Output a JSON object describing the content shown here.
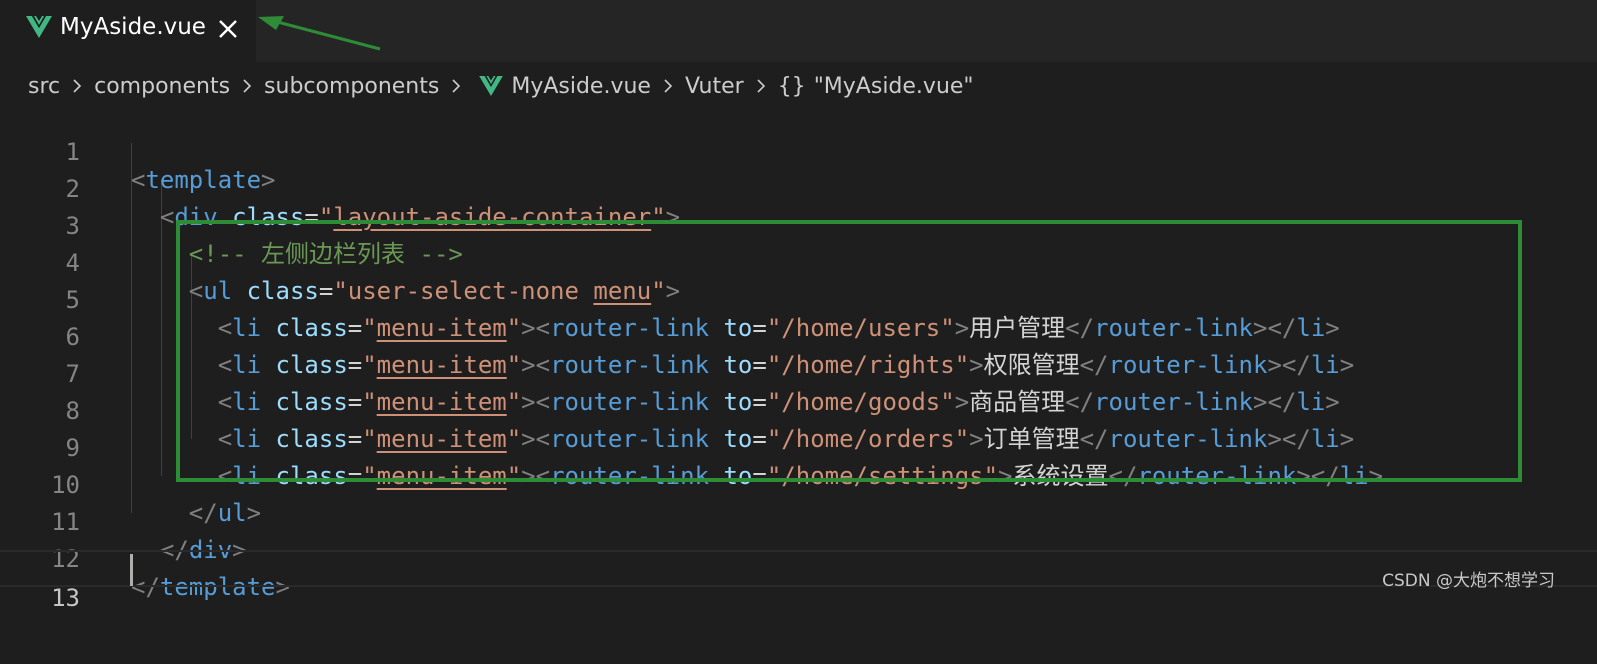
{
  "tab": {
    "label": "MyAside.vue",
    "icon": "vue-icon",
    "close_icon": "close-icon"
  },
  "breadcrumb": {
    "items": [
      "src",
      "components",
      "subcomponents",
      "MyAside.vue",
      "Vuter",
      "\"MyAside.vue\""
    ],
    "braces": "{}"
  },
  "editor": {
    "lines": [
      {
        "number": "1"
      },
      {
        "number": "2"
      },
      {
        "number": "3"
      },
      {
        "number": "4"
      },
      {
        "number": "5"
      },
      {
        "number": "6"
      },
      {
        "number": "7"
      },
      {
        "number": "8"
      },
      {
        "number": "9"
      },
      {
        "number": "10"
      },
      {
        "number": "11"
      },
      {
        "number": "12"
      },
      {
        "number": "13"
      }
    ],
    "code": {
      "l1_tag": "template",
      "l2_tag": "div",
      "l2_attr": "class",
      "l2_value": "layout-aside-container",
      "l3_comment": "<!-- 左侧边栏列表 -->",
      "l4_tag": "ul",
      "l4_attr": "class",
      "l4_value_a": "user-select-none ",
      "l4_value_b": "menu",
      "li_tag": "li",
      "li_attr": "class",
      "li_value": "menu-item",
      "rl_tag": "router-link",
      "rl_attr": "to",
      "items": [
        {
          "to": "/home/users",
          "text": "用户管理"
        },
        {
          "to": "/home/rights",
          "text": "权限管理"
        },
        {
          "to": "/home/goods",
          "text": "商品管理"
        },
        {
          "to": "/home/orders",
          "text": "订单管理"
        },
        {
          "to": "/home/settings",
          "text": "系统设置"
        }
      ],
      "l10_tag": "ul",
      "l11_tag": "div",
      "l12_tag": "template"
    }
  },
  "watermark": "CSDN @大炮不想学习",
  "colors": {
    "background": "#1e1e1e",
    "tag": "#569cd6",
    "attribute": "#9cdcfe",
    "string": "#ce9178",
    "comment": "#6a9955",
    "highlight_box": "#2e8b36",
    "vue_green": "#41b883"
  }
}
